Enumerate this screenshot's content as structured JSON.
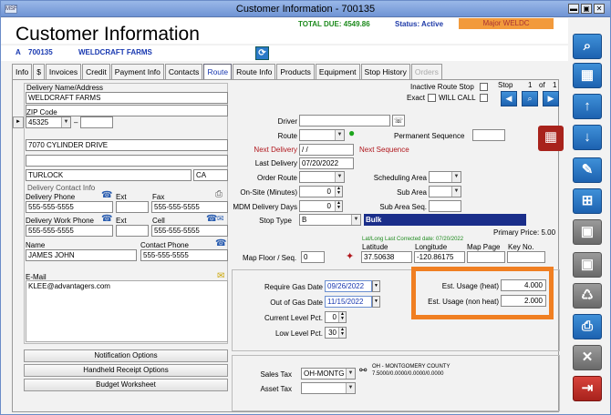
{
  "window": {
    "title": "Customer Information - 700135",
    "sys_icon": "MSF"
  },
  "header": {
    "title": "Customer Information",
    "total_due": "TOTAL DUE: 4549.86",
    "status": "Status: Active",
    "major": "Major WELDC"
  },
  "account": {
    "prefix": "A",
    "number": "700135",
    "name": "WELDCRAFT FARMS"
  },
  "tabs": [
    "Info",
    "$",
    "Invoices",
    "Credit",
    "Payment Info",
    "Contacts",
    "Route",
    "Route Info",
    "Products",
    "Equipment",
    "Stop History",
    "Orders"
  ],
  "active_tab": "Route",
  "left": {
    "delivery_name_label": "Delivery Name/Address",
    "name": "WELDCRAFT FARMS",
    "zip_label": "ZIP Code",
    "zip": "45325",
    "zip_ext_sep": "–",
    "address1": "7070 CYLINDER DRIVE",
    "city": "TURLOCK",
    "state": "CA",
    "contact_group": "Delivery Contact Info",
    "delivery_phone_label": "Delivery Phone",
    "delivery_phone": "555-555-5555",
    "ext_label": "Ext",
    "fax_label": "Fax",
    "fax": "555-555-5555",
    "work_phone_label": "Delivery Work Phone",
    "work_phone": "555-555-5555",
    "ext2_label": "Ext",
    "cell_label": "Cell",
    "cell": "555-555-5555",
    "name_label": "Name",
    "contact_name": "JAMES JOHN",
    "contact_phone_label": "Contact Phone",
    "contact_phone": "555-555-5555",
    "email_label": "E-Mail",
    "email": "KLEE@advantagers.com",
    "btn_notification": "Notification Options",
    "btn_handheld": "Handheld Receipt Options",
    "btn_budget": "Budget Worksheet"
  },
  "route": {
    "inactive_label": "Inactive Route Stop",
    "exact_label": "Exact",
    "willcall_label": "WILL CALL",
    "stop_label": "Stop",
    "stop_num": "1",
    "of_label": "of",
    "stop_total": "1",
    "driver_label": "Driver",
    "route_label": "Route",
    "perm_seq_label": "Permanent Sequence",
    "next_delivery_label": "Next Delivery",
    "next_delivery": " / /",
    "next_sequence_label": "Next Sequence",
    "last_delivery_label": "Last Delivery",
    "last_delivery": "07/20/2022",
    "order_route_label": "Order Route",
    "sched_area_label": "Scheduling Area",
    "onsite_label": "On-Site (Minutes)",
    "onsite": "0",
    "sub_area_label": "Sub Area",
    "mdm_label": "MDM Delivery Days",
    "mdm": "0",
    "sub_area_seq_label": "Sub Area Seq.",
    "stop_type_label": "Stop Type",
    "stop_type": "B",
    "stop_type_desc": "Bulk",
    "primary_price": "Primary Price: 5.00",
    "latlong_note": "Lat/Long Last Corrected date: 07/20/2022",
    "map_floor_label": "Map Floor / Seq.",
    "map_floor": "0",
    "latitude_label": "Latitude",
    "latitude": "37.50638",
    "longitude_label": "Longitude",
    "longitude": "-120.86175",
    "map_page_label": "Map Page",
    "key_no_label": "Key No.",
    "req_gas_label": "Require Gas Date",
    "req_gas": "09/26/2022",
    "out_gas_label": "Out of Gas Date",
    "out_gas": "11/15/2022",
    "cur_level_label": "Current Level Pct.",
    "cur_level": "0",
    "low_level_label": "Low Level Pct.",
    "low_level": "30",
    "est_heat_label": "Est. Usage (heat)",
    "est_heat": "4.000",
    "est_nonheat_label": "Est. Usage (non heat)",
    "est_nonheat": "2.000",
    "sales_tax_label": "Sales Tax",
    "sales_tax": "OH-MONTG",
    "tax_desc1": "OH - MONTGOMERY COUNTY",
    "tax_desc2": "7.5000/0.0000/0.0000/0.0000",
    "asset_tax_label": "Asset Tax"
  }
}
